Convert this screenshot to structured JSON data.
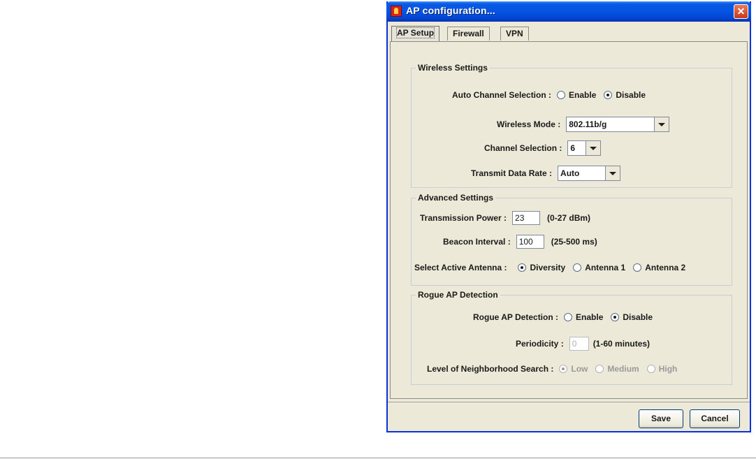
{
  "window": {
    "title": "AP configuration..."
  },
  "tabs": [
    {
      "label": "AP Setup",
      "active": true
    },
    {
      "label": "Firewall",
      "active": false
    },
    {
      "label": "VPN",
      "active": false
    }
  ],
  "wireless": {
    "legend": "Wireless Settings",
    "auto_channel": {
      "label": "Auto Channel Selection :",
      "options": [
        "Enable",
        "Disable"
      ],
      "selected": "Disable"
    },
    "mode": {
      "label": "Wireless Mode :",
      "value": "802.11b/g"
    },
    "channel": {
      "label": "Channel Selection :",
      "value": "6"
    },
    "rate": {
      "label": "Transmit Data Rate :",
      "value": "Auto"
    }
  },
  "advanced": {
    "legend": "Advanced Settings",
    "power": {
      "label": "Transmission Power :",
      "value": "23",
      "hint": "(0-27 dBm)"
    },
    "beacon": {
      "label": "Beacon Interval :",
      "value": "100",
      "hint": "(25-500 ms)"
    },
    "antenna": {
      "label": "Select Active Antenna :",
      "options": [
        "Diversity",
        "Antenna 1",
        "Antenna 2"
      ],
      "selected": "Diversity"
    }
  },
  "rogue": {
    "legend": "Rogue AP Detection",
    "detection": {
      "label": "Rogue AP Detection :",
      "options": [
        "Enable",
        "Disable"
      ],
      "selected": "Disable"
    },
    "periodicity": {
      "label": "Periodicity :",
      "value": "0",
      "hint": "(1-60 minutes)"
    },
    "level": {
      "label": "Level of Neighborhood Search :",
      "options": [
        "Low",
        "Medium",
        "High"
      ],
      "selected": "Low"
    }
  },
  "buttons": {
    "save": "Save",
    "cancel": "Cancel"
  },
  "colors": {
    "titlebar": "#0554e3",
    "dialog_bg": "#ece9d8",
    "group_border": "#c4cdd8",
    "close": "#c8381b"
  }
}
